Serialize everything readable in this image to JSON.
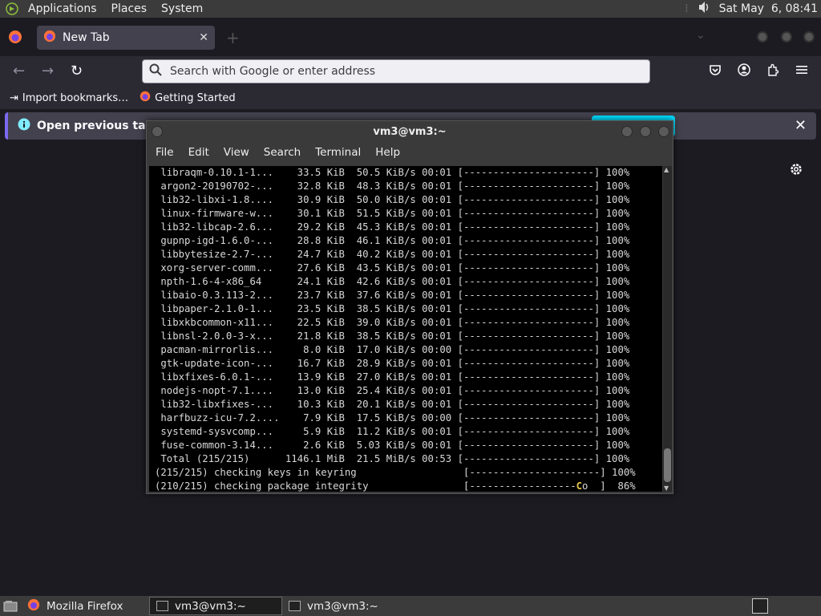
{
  "top_panel": {
    "menus": [
      "Applications",
      "Places",
      "System"
    ],
    "clock": "Sat May  6, 08:41"
  },
  "firefox": {
    "tab_title": "New Tab",
    "url_placeholder": "Search with Google or enter address",
    "bookmarks": [
      "Import bookmarks…",
      "Getting Started"
    ],
    "notification": "Open previous tabs?"
  },
  "terminal": {
    "title": "vm3@vm3:~",
    "menu": [
      "File",
      "Edit",
      "View",
      "Search",
      "Terminal",
      "Help"
    ],
    "lines": [
      " libraqm-0.10.1-1...    33.5 KiB  50.5 KiB/s 00:01 [----------------------] 100%",
      " argon2-20190702-...    32.8 KiB  48.3 KiB/s 00:01 [----------------------] 100%",
      " lib32-libxi-1.8....    30.9 KiB  50.0 KiB/s 00:01 [----------------------] 100%",
      " linux-firmware-w...    30.1 KiB  51.5 KiB/s 00:01 [----------------------] 100%",
      " lib32-libcap-2.6...    29.2 KiB  45.3 KiB/s 00:01 [----------------------] 100%",
      " gupnp-igd-1.6.0-...    28.8 KiB  46.1 KiB/s 00:01 [----------------------] 100%",
      " libbytesize-2.7-...    24.7 KiB  40.2 KiB/s 00:01 [----------------------] 100%",
      " xorg-server-comm...    27.6 KiB  43.5 KiB/s 00:01 [----------------------] 100%",
      " npth-1.6-4-x86_64      24.1 KiB  42.6 KiB/s 00:01 [----------------------] 100%",
      " libaio-0.3.113-2...    23.7 KiB  37.6 KiB/s 00:01 [----------------------] 100%",
      " libpaper-2.1.0-1...    23.5 KiB  38.5 KiB/s 00:01 [----------------------] 100%",
      " libxkbcommon-x11...    22.5 KiB  39.0 KiB/s 00:01 [----------------------] 100%",
      " libnsl-2.0.0-3-x...    21.8 KiB  38.5 KiB/s 00:01 [----------------------] 100%",
      " pacman-mirrorlis...     8.0 KiB  17.0 KiB/s 00:00 [----------------------] 100%",
      " gtk-update-icon-...    16.7 KiB  28.9 KiB/s 00:01 [----------------------] 100%",
      " libxfixes-6.0.1-...    13.9 KiB  27.0 KiB/s 00:01 [----------------------] 100%",
      " nodejs-nopt-7.1....    13.0 KiB  25.4 KiB/s 00:01 [----------------------] 100%",
      " lib32-libxfixes-...    10.3 KiB  20.1 KiB/s 00:01 [----------------------] 100%",
      " harfbuzz-icu-7.2....    7.9 KiB  17.5 KiB/s 00:00 [----------------------] 100%",
      " systemd-sysvcomp...     5.9 KiB  11.2 KiB/s 00:01 [----------------------] 100%",
      " fuse-common-3.14...     2.6 KiB  5.03 KiB/s 00:01 [----------------------] 100%",
      " Total (215/215)      1146.1 MiB  21.5 MiB/s 00:53 [----------------------] 100%",
      "(215/215) checking keys in keyring                  [----------------------] 100%"
    ],
    "last_line_prefix": "(210/215) checking package integrity                [------------------",
    "last_line_cursor": "C",
    "last_line_suffix": "o  ]  86%"
  },
  "taskbar": {
    "items": [
      "Mozilla Firefox",
      "vm3@vm3:~",
      "vm3@vm3:~"
    ]
  }
}
